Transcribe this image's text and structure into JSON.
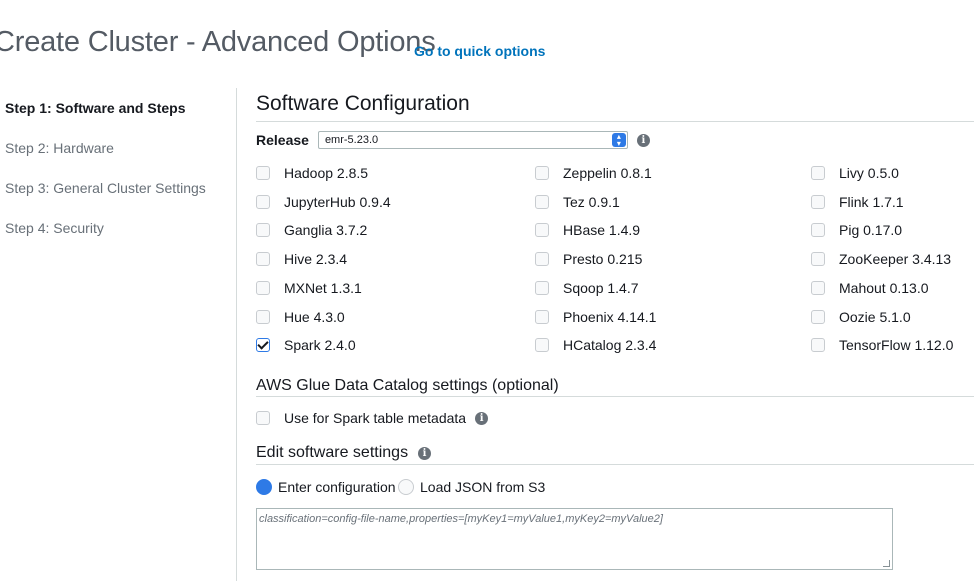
{
  "header": {
    "title": "Create Cluster - Advanced Options",
    "quick_link": "Go to quick options"
  },
  "steps": [
    {
      "label": "Step 1: Software and Steps",
      "active": true
    },
    {
      "label": "Step 2: Hardware",
      "active": false
    },
    {
      "label": "Step 3: General Cluster Settings",
      "active": false
    },
    {
      "label": "Step 4: Security",
      "active": false
    }
  ],
  "software": {
    "title": "Software Configuration",
    "release_label": "Release",
    "release_value": "emr-5.23.0",
    "apps": [
      [
        {
          "name": "Hadoop 2.8.5",
          "checked": false
        },
        {
          "name": "JupyterHub 0.9.4",
          "checked": false
        },
        {
          "name": "Ganglia 3.7.2",
          "checked": false
        },
        {
          "name": "Hive 2.3.4",
          "checked": false
        },
        {
          "name": "MXNet 1.3.1",
          "checked": false
        },
        {
          "name": "Hue 4.3.0",
          "checked": false
        },
        {
          "name": "Spark 2.4.0",
          "checked": true
        }
      ],
      [
        {
          "name": "Zeppelin 0.8.1",
          "checked": false
        },
        {
          "name": "Tez 0.9.1",
          "checked": false
        },
        {
          "name": "HBase 1.4.9",
          "checked": false
        },
        {
          "name": "Presto 0.215",
          "checked": false
        },
        {
          "name": "Sqoop 1.4.7",
          "checked": false
        },
        {
          "name": "Phoenix 4.14.1",
          "checked": false
        },
        {
          "name": "HCatalog 2.3.4",
          "checked": false
        }
      ],
      [
        {
          "name": "Livy 0.5.0",
          "checked": false
        },
        {
          "name": "Flink 1.7.1",
          "checked": false
        },
        {
          "name": "Pig 0.17.0",
          "checked": false
        },
        {
          "name": "ZooKeeper 3.4.13",
          "checked": false
        },
        {
          "name": "Mahout 0.13.0",
          "checked": false
        },
        {
          "name": "Oozie 5.1.0",
          "checked": false
        },
        {
          "name": "TensorFlow 1.12.0",
          "checked": false
        }
      ]
    ]
  },
  "glue": {
    "title": "AWS Glue Data Catalog settings (optional)",
    "option_label": "Use for Spark table metadata",
    "checked": false
  },
  "edit_settings": {
    "title": "Edit software settings",
    "radio_enter": "Enter configuration",
    "radio_load": "Load JSON from S3",
    "selected": "enter",
    "placeholder": "classification=config-file-name,properties=[myKey1=myValue1,myKey2=myValue2]"
  },
  "colors": {
    "accent": "#2e7ae6",
    "link": "#0073bb",
    "divider": "#d5dbdb"
  },
  "icons": {
    "info": "info-circle-icon",
    "select": "select-arrows-icon"
  }
}
